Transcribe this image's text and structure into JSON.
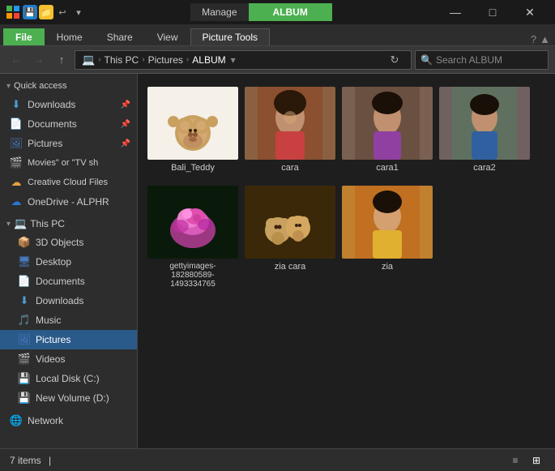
{
  "titleBar": {
    "manage_label": "Manage",
    "album_label": "ALBUM",
    "minimize": "—",
    "maximize": "□",
    "close": "✕"
  },
  "ribbon": {
    "tabs": [
      {
        "id": "file",
        "label": "File",
        "active": false,
        "file": true
      },
      {
        "id": "home",
        "label": "Home",
        "active": false
      },
      {
        "id": "share",
        "label": "Share",
        "active": false
      },
      {
        "id": "view",
        "label": "View",
        "active": false
      },
      {
        "id": "picture",
        "label": "Picture Tools",
        "active": true
      }
    ]
  },
  "addressBar": {
    "back_title": "Back",
    "forward_title": "Forward",
    "up_title": "Up",
    "path": [
      "This PC",
      "Pictures",
      "ALBUM"
    ],
    "search_placeholder": "Search ALBUM"
  },
  "sidebar": {
    "quickAccess": [
      {
        "id": "dl-quick",
        "label": "Downloads",
        "icon": "⬇",
        "iconClass": "icon-dl",
        "pin": true
      },
      {
        "id": "doc-quick",
        "label": "Documents",
        "icon": "📄",
        "iconClass": "icon-doc",
        "pin": true
      },
      {
        "id": "pic-quick",
        "label": "Pictures",
        "icon": "🖼",
        "iconClass": "icon-pic",
        "pin": true
      },
      {
        "id": "mov-quick",
        "label": "Movies\" or \"TV sh",
        "icon": "🎬",
        "iconClass": "icon-mov",
        "pin": false
      }
    ],
    "cloudItems": [
      {
        "id": "cc",
        "label": "Creative Cloud Files",
        "icon": "☁",
        "iconClass": "icon-cc"
      },
      {
        "id": "od",
        "label": "OneDrive - ALPHR",
        "icon": "☁",
        "iconClass": "icon-od"
      }
    ],
    "thisPC": {
      "header": "This PC",
      "items": [
        {
          "id": "3d",
          "label": "3D Objects",
          "icon": "📦",
          "iconClass": "icon-3d"
        },
        {
          "id": "desk",
          "label": "Desktop",
          "icon": "🖥",
          "iconClass": "icon-desk"
        },
        {
          "id": "docs",
          "label": "Documents",
          "icon": "📄",
          "iconClass": "icon-doc"
        },
        {
          "id": "dl",
          "label": "Downloads",
          "icon": "⬇",
          "iconClass": "icon-dl"
        },
        {
          "id": "mus",
          "label": "Music",
          "icon": "🎵",
          "iconClass": "icon-mus"
        },
        {
          "id": "pic",
          "label": "Pictures",
          "icon": "🖼",
          "iconClass": "icon-pic",
          "active": true
        },
        {
          "id": "vid",
          "label": "Videos",
          "icon": "🎬",
          "iconClass": "icon-vid"
        },
        {
          "id": "local",
          "label": "Local Disk (C:)",
          "icon": "💾",
          "iconClass": "icon-hdd"
        },
        {
          "id": "newvol",
          "label": "New Volume (D:)",
          "icon": "💾",
          "iconClass": "icon-hdd"
        }
      ]
    },
    "network": {
      "label": "Network",
      "icon": "🌐",
      "iconClass": "icon-net"
    }
  },
  "content": {
    "items": [
      {
        "id": "bali",
        "label": "Bali_Teddy",
        "bg": "#f0ece0",
        "type": "bear"
      },
      {
        "id": "cara",
        "label": "cara",
        "bg": "#b08060",
        "type": "girl"
      },
      {
        "id": "cara1",
        "label": "cara1",
        "bg": "#c09070",
        "type": "girl"
      },
      {
        "id": "cara2",
        "label": "cara2",
        "bg": "#8a7065",
        "type": "girl"
      },
      {
        "id": "getty",
        "label": "gettyimages-182880589-14933347\n65",
        "bg": "#0a2010",
        "type": "flower"
      },
      {
        "id": "zia-cara",
        "label": "zia cara",
        "bg": "#3a2810",
        "type": "teddy2"
      },
      {
        "id": "zia",
        "label": "zia",
        "bg": "#d09040",
        "type": "girl3"
      }
    ]
  },
  "statusBar": {
    "count": "7 items",
    "separator": "|"
  }
}
